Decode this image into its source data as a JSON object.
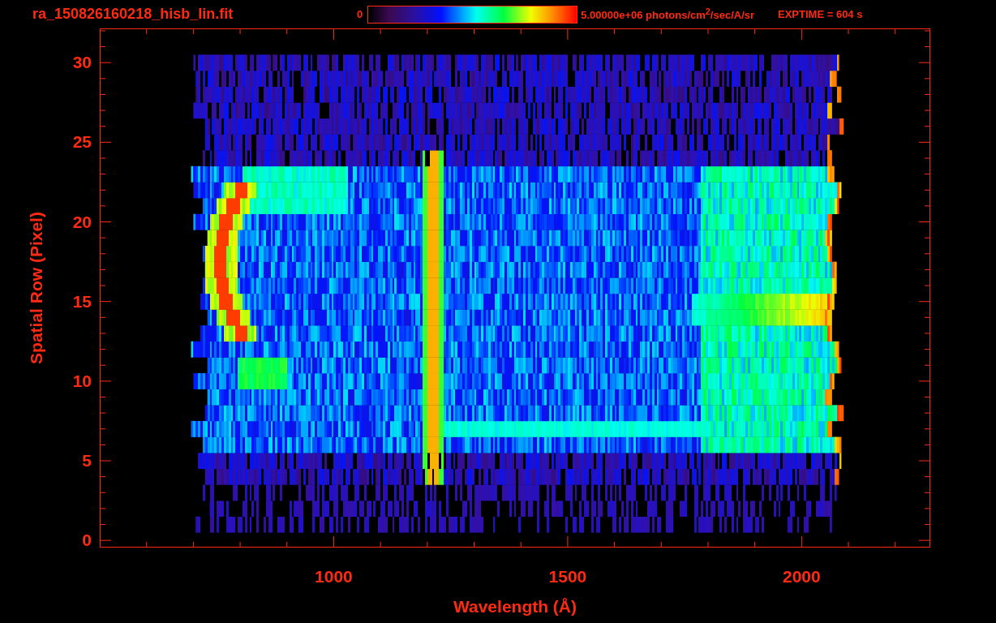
{
  "title": "ra_150826160218_hisb_lin.fit",
  "colorbar": {
    "min_label": "0",
    "max_label": "5.00000e+06 photons/cm$^{2}$/sec/A/sr"
  },
  "exposure": "EXPTIME = 604 s",
  "y_axis": {
    "label": "Spatial Row (Pixel)",
    "ticks": [
      "30",
      "25",
      "20",
      "15",
      "10",
      "5",
      "0"
    ]
  },
  "x_axis": {
    "label": "Wavelength (Å)",
    "ticks": [
      "1000",
      "1500",
      "2000"
    ]
  }
}
